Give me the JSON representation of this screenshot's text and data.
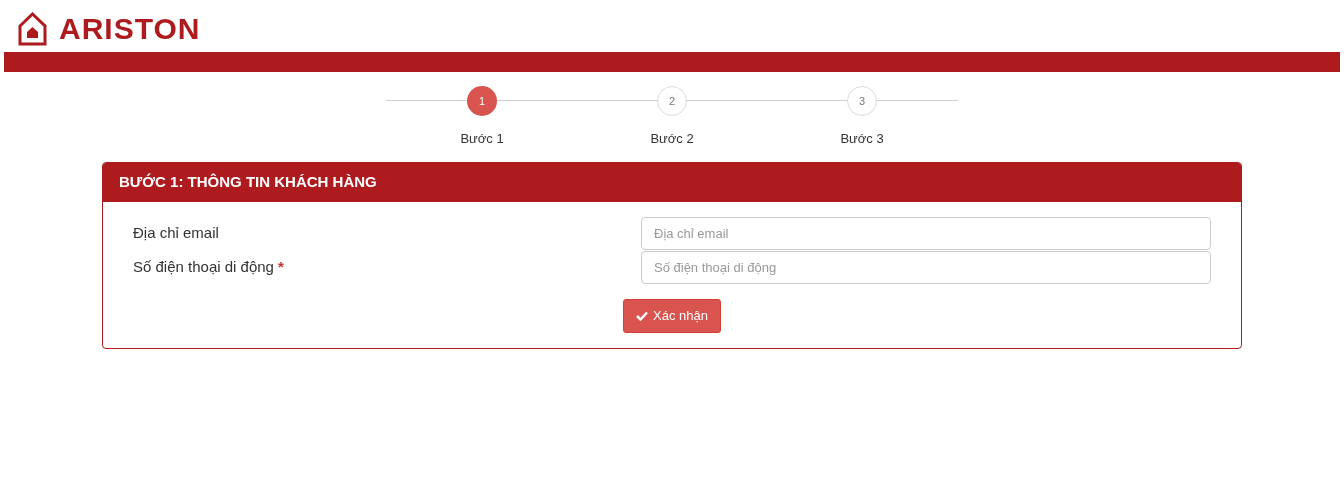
{
  "logo": {
    "text": "ARISTON"
  },
  "steps": [
    {
      "number": "1",
      "label": "Bước 1",
      "selected": true
    },
    {
      "number": "2",
      "label": "Bước 2",
      "selected": false
    },
    {
      "number": "3",
      "label": "Bước 3",
      "selected": false
    }
  ],
  "panel": {
    "title": "BƯỚC 1: THÔNG TIN KHÁCH HÀNG",
    "fields": [
      {
        "label": "Địa chỉ email",
        "placeholder": "Địa chỉ email"
      },
      {
        "label": "Số điện thoại di động",
        "placeholder": "Số điện thoại di động",
        "required_mark": "*"
      }
    ],
    "submit": "Xác nhận"
  }
}
